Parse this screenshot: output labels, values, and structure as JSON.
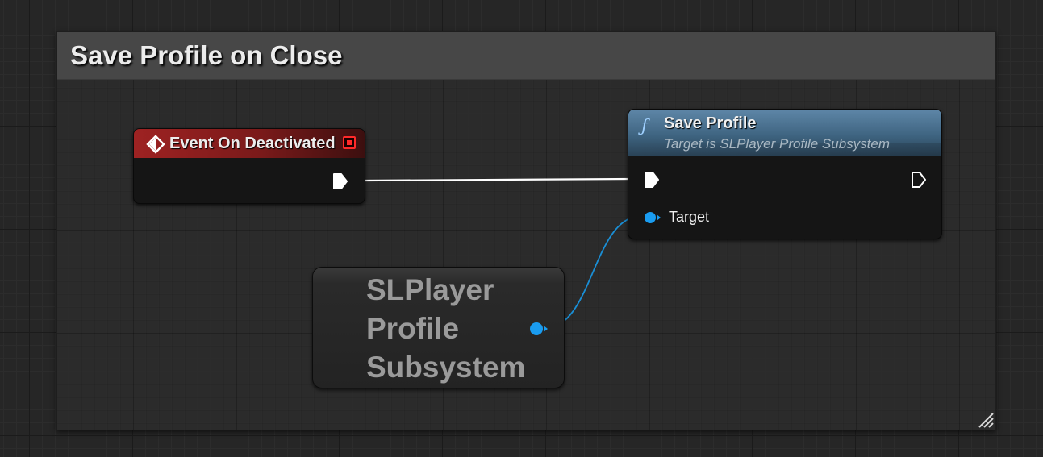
{
  "comment": {
    "title": "Save Profile on Close"
  },
  "event_node": {
    "title": "Event On Deactivated",
    "icon": "event-diamond-icon",
    "delegate_pin_color": "#ff2a2a",
    "header_color": "#9e2222"
  },
  "save_node": {
    "icon": "function-icon",
    "icon_glyph": "ƒ",
    "title": "Save Profile",
    "subtitle": "Target is SLPlayer Profile Subsystem",
    "target_label": "Target",
    "header_color": "#4f7595"
  },
  "subsystem_node": {
    "label": "SLPlayer Profile Subsystem",
    "pin_color": "#1a9cf0"
  },
  "colors": {
    "exec_wire": "#ffffff",
    "object_wire": "#1a8fd6",
    "object_pin": "#1a9cf0"
  }
}
